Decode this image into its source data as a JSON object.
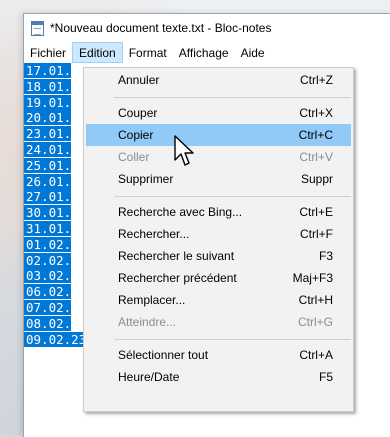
{
  "window": {
    "title": "*Nouveau document texte.txt - Bloc-notes"
  },
  "menubar": [
    {
      "label": "Fichier"
    },
    {
      "label": "Edition"
    },
    {
      "label": "Format"
    },
    {
      "label": "Affichage"
    },
    {
      "label": "Aide"
    }
  ],
  "editor_lines": [
    "17.01.",
    "18.01.",
    "19.01.",
    "20.01.",
    "23.01.",
    "24.01.",
    "25.01.",
    "26.01.",
    "27.01.",
    "30.01.",
    "31.01.",
    "01.02.",
    "02.02.",
    "03.02.",
    "06.02.",
    "07.02.",
    "08.02.",
    "09.02.23;25"
  ],
  "edit_menu": [
    {
      "label": "Annuler",
      "shortcut": "Ctrl+Z",
      "disabled": false
    },
    {
      "label": "Couper",
      "shortcut": "Ctrl+X",
      "disabled": false
    },
    {
      "label": "Copier",
      "shortcut": "Ctrl+C",
      "disabled": false,
      "hover": true
    },
    {
      "label": "Coller",
      "shortcut": "Ctrl+V",
      "disabled": true
    },
    {
      "label": "Supprimer",
      "shortcut": "Suppr",
      "disabled": false
    },
    {
      "label": "Recherche avec Bing...",
      "shortcut": "Ctrl+E",
      "disabled": false
    },
    {
      "label": "Rechercher...",
      "shortcut": "Ctrl+F",
      "disabled": false
    },
    {
      "label": "Rechercher le suivant",
      "shortcut": "F3",
      "disabled": false
    },
    {
      "label": "Rechercher précédent",
      "shortcut": "Maj+F3",
      "disabled": false
    },
    {
      "label": "Remplacer...",
      "shortcut": "Ctrl+H",
      "disabled": false
    },
    {
      "label": "Atteindre...",
      "shortcut": "Ctrl+G",
      "disabled": true
    },
    {
      "label": "Sélectionner tout",
      "shortcut": "Ctrl+A",
      "disabled": false
    },
    {
      "label": "Heure/Date",
      "shortcut": "F5",
      "disabled": false
    }
  ],
  "colors": {
    "selection": "#0078d7",
    "menu_hover": "#91c9f7",
    "menubar_active": "#cce8ff"
  }
}
